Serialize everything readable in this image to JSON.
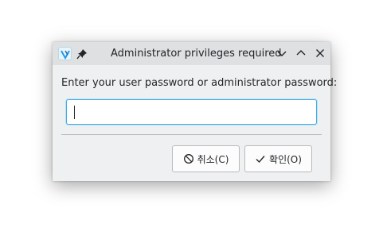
{
  "window": {
    "title": "Administrator privileges required",
    "icons": {
      "app": "kde-app-icon",
      "pin": "pin-icon",
      "minimize": "chevron-down-icon",
      "maximize": "chevron-up-icon",
      "close": "close-icon"
    }
  },
  "dialog": {
    "prompt": "Enter your user password or administrator password:",
    "password": {
      "value": "",
      "placeholder": ""
    },
    "buttons": {
      "cancel_label": "취소(C)",
      "cancel_icon": "cancel-circle-icon",
      "ok_label": "확인(O)",
      "ok_icon": "checkmark-icon"
    }
  },
  "colors": {
    "titlebar": "#dee0e2",
    "body": "#eff0f1",
    "focus": "#3daee9",
    "text": "#232629"
  }
}
